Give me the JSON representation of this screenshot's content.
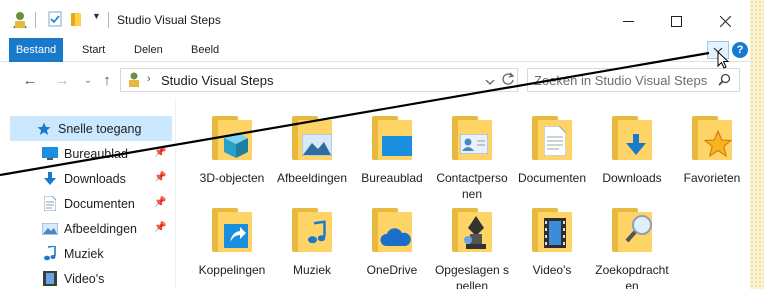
{
  "window": {
    "title": "Studio Visual Steps"
  },
  "ribbon": {
    "tabs": [
      {
        "label": "Bestand"
      },
      {
        "label": "Start"
      },
      {
        "label": "Delen"
      },
      {
        "label": "Beeld"
      }
    ],
    "help_label": "?"
  },
  "address": {
    "path": "Studio Visual Steps"
  },
  "search": {
    "placeholder": "Zoeken in Studio Visual Steps"
  },
  "sidebar": {
    "items": [
      {
        "label": "Snelle toegang",
        "icon": "star-icon"
      },
      {
        "label": "Bureaublad",
        "icon": "desktop-icon",
        "pinned": true
      },
      {
        "label": "Downloads",
        "icon": "download-icon",
        "pinned": true
      },
      {
        "label": "Documenten",
        "icon": "document-icon",
        "pinned": true
      },
      {
        "label": "Afbeeldingen",
        "icon": "picture-icon",
        "pinned": true
      },
      {
        "label": "Muziek",
        "icon": "music-icon"
      },
      {
        "label": "Video's",
        "icon": "video-icon"
      }
    ]
  },
  "folders": {
    "items": [
      {
        "label": "3D-objecten",
        "badge": "cube"
      },
      {
        "label": "Afbeeldingen",
        "badge": "picture"
      },
      {
        "label": "Bureaublad",
        "badge": "desktop"
      },
      {
        "label": "Contactpersonen",
        "badge": "contact"
      },
      {
        "label": "Documenten",
        "badge": "document"
      },
      {
        "label": "Downloads",
        "badge": "download"
      },
      {
        "label": "Favorieten",
        "badge": "star"
      },
      {
        "label": "Koppelingen",
        "badge": "link"
      },
      {
        "label": "Muziek",
        "badge": "music"
      },
      {
        "label": "OneDrive",
        "badge": "cloud"
      },
      {
        "label": "Opgeslagen spellen",
        "badge": "game"
      },
      {
        "label": "Video's",
        "badge": "film"
      },
      {
        "label": "Zoekopdrachten",
        "badge": "search"
      }
    ]
  },
  "colors": {
    "accent": "#1979ca",
    "folder": "#ffd466",
    "selected": "#cce8ff"
  }
}
